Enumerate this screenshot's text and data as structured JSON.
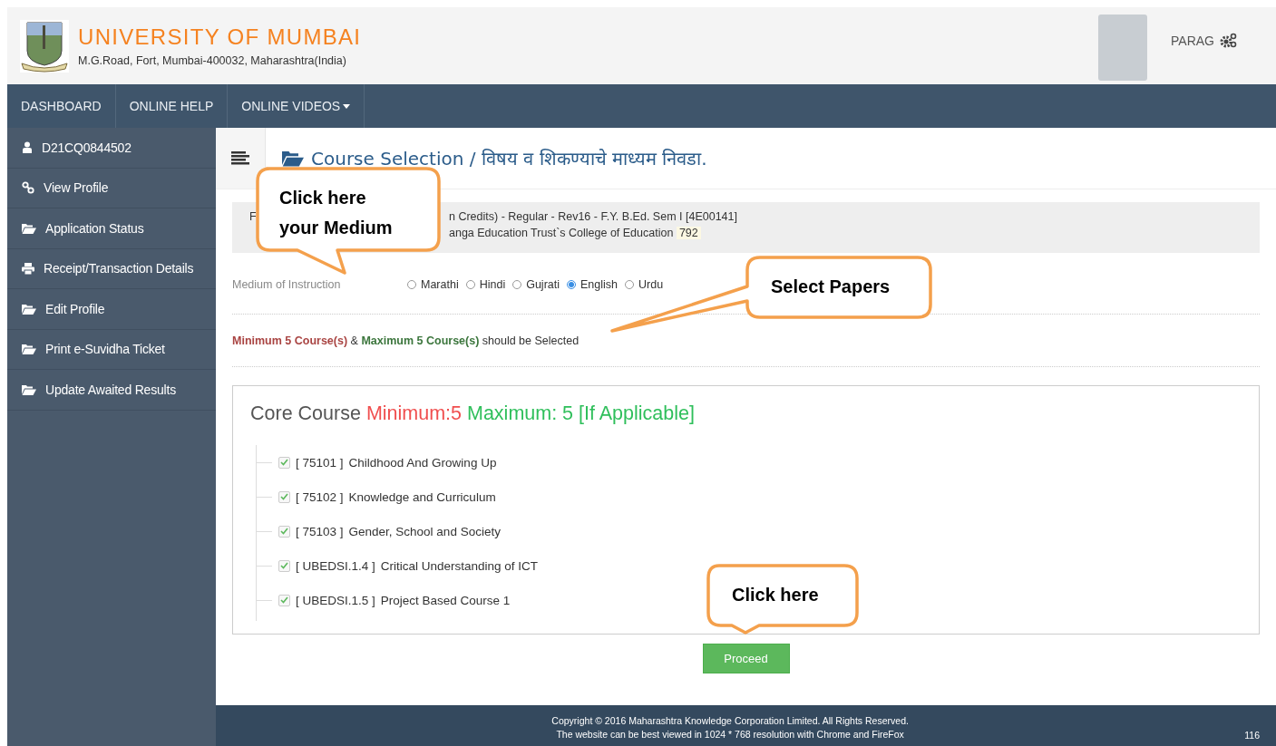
{
  "header": {
    "title": "UNIVERSITY OF MUMBAI",
    "address": "M.G.Road, Fort, Mumbai-400032, Maharashtra(India)",
    "user_name": "PARAG"
  },
  "navbar": [
    {
      "label": "DASHBOARD",
      "dropdown": false
    },
    {
      "label": "ONLINE HELP",
      "dropdown": false
    },
    {
      "label": "ONLINE VIDEOS",
      "dropdown": true
    }
  ],
  "sidebar": {
    "items": [
      {
        "label": "D21CQ0844502",
        "kind": "user"
      },
      {
        "label": "View Profile",
        "kind": "link"
      },
      {
        "label": "Application Status",
        "kind": "folder"
      },
      {
        "label": "Receipt/Transaction Details",
        "kind": "print"
      },
      {
        "label": "Edit Profile",
        "kind": "folder"
      },
      {
        "label": "Print e-Suvidha Ticket",
        "kind": "folder"
      },
      {
        "label": "Update Awaited Results",
        "kind": "folder"
      }
    ]
  },
  "page_title": "Course Selection / विषय व शिकण्याचे माध्यम निवडा.",
  "info": {
    "line_1_start": "F",
    "line_1": "n Credits) - Regular - Rev16 - F.Y. B.Ed. Sem I [4E00141]",
    "line_2": "anga Education Trust`s College of Education",
    "code": "792"
  },
  "medium": {
    "label": "Medium of Instruction",
    "options": [
      {
        "label": "Marathi",
        "selected": false
      },
      {
        "label": "Hindi",
        "selected": false
      },
      {
        "label": "Gujrati",
        "selected": false
      },
      {
        "label": "English",
        "selected": true
      },
      {
        "label": "Urdu",
        "selected": false
      }
    ]
  },
  "rule_note": {
    "minimum": "Minimum 5 Course(s)",
    "joiner": "&",
    "maximum": "Maximum 5 Course(s)",
    "tail": "should be Selected"
  },
  "core_course": {
    "heading": "Core Course",
    "minimum": "Minimum:5",
    "maximum": "Maximum: 5 [If Applicable]",
    "courses": [
      {
        "code": "[ 75101 ]",
        "name": "Childhood And Growing Up",
        "checked": true
      },
      {
        "code": "[ 75102 ]",
        "name": "Knowledge and Curriculum",
        "checked": true
      },
      {
        "code": "[ 75103 ]",
        "name": "Gender, School and Society",
        "checked": true
      },
      {
        "code": "[ UBEDSI.1.4 ]",
        "name": "Critical Understanding of ICT",
        "checked": true
      },
      {
        "code": "[ UBEDSI.1.5 ]",
        "name": "Project Based Course 1",
        "checked": true
      }
    ]
  },
  "proceed_button": "Proceed",
  "callouts": [
    {
      "kind": "medium",
      "lines": [
        "Click here",
        "your Medium"
      ]
    },
    {
      "kind": "papers",
      "lines": [
        "Select Papers"
      ]
    },
    {
      "kind": "proceed",
      "lines": [
        "Click here"
      ]
    }
  ],
  "footer": {
    "copyright": "Copyright © 2016 Maharashtra Knowledge Corporation Limited. All Rights Reserved.",
    "note": "The website can be best viewed in 1024 * 768 resolution with Chrome and FireFox",
    "page_number": "116"
  }
}
